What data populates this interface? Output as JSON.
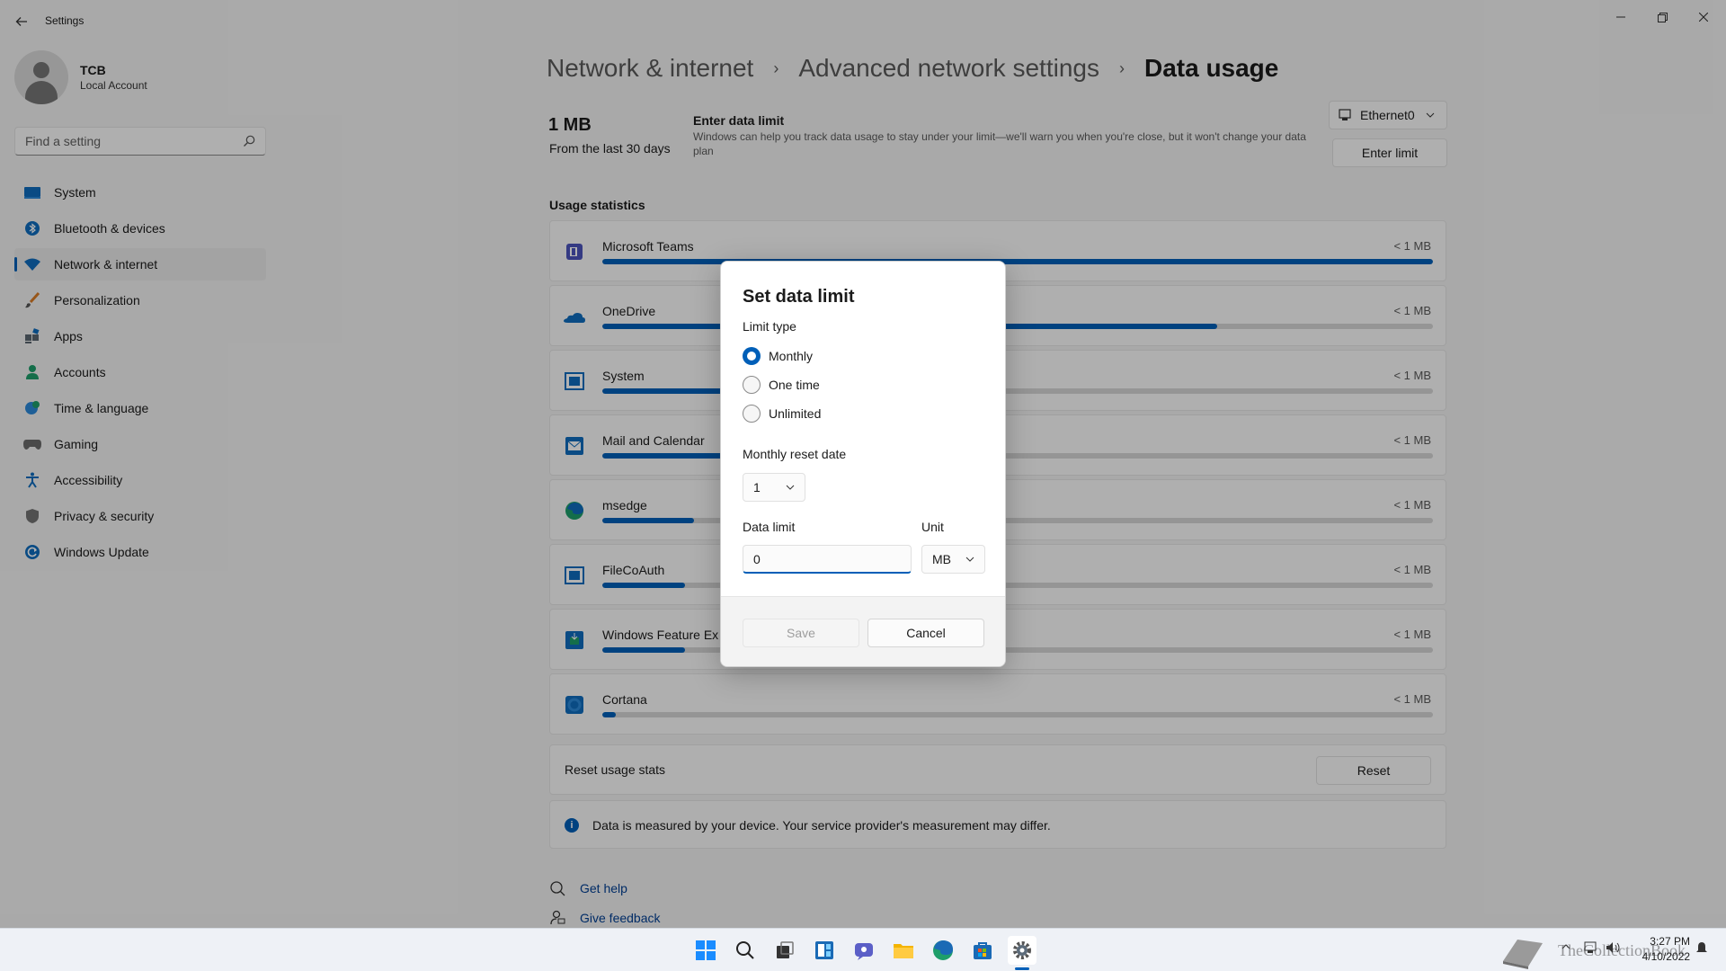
{
  "window": {
    "title": "Settings",
    "back_icon": "back-arrow-icon",
    "controls": [
      "minimize-icon",
      "maximize-icon",
      "close-icon"
    ]
  },
  "profile": {
    "name": "TCB",
    "account": "Local Account"
  },
  "search": {
    "placeholder": "Find a setting"
  },
  "sidebar": {
    "items": [
      {
        "label": "System",
        "icon": "system-icon"
      },
      {
        "label": "Bluetooth & devices",
        "icon": "bluetooth-icon"
      },
      {
        "label": "Network & internet",
        "icon": "wifi-icon",
        "active": true
      },
      {
        "label": "Personalization",
        "icon": "brush-icon"
      },
      {
        "label": "Apps",
        "icon": "apps-icon"
      },
      {
        "label": "Accounts",
        "icon": "accounts-icon"
      },
      {
        "label": "Time & language",
        "icon": "globe-clock-icon"
      },
      {
        "label": "Gaming",
        "icon": "gamepad-icon"
      },
      {
        "label": "Accessibility",
        "icon": "accessibility-icon"
      },
      {
        "label": "Privacy & security",
        "icon": "shield-icon"
      },
      {
        "label": "Windows Update",
        "icon": "update-icon"
      }
    ]
  },
  "breadcrumb": {
    "items": [
      "Network & internet",
      "Advanced network settings"
    ],
    "current": "Data usage"
  },
  "summary": {
    "amount": "1 MB",
    "period": "From the last 30 days",
    "limit_title": "Enter data limit",
    "limit_description": "Windows can help you track data usage to stay under your limit—we'll warn you when you're close, but it won't change your data plan",
    "adapter": "Ethernet0",
    "enter_limit_label": "Enter limit"
  },
  "usage": {
    "title": "Usage statistics",
    "apps": [
      {
        "name": "Microsoft Teams",
        "amount": "< 1 MB",
        "fraction": 1.0,
        "icon": "teams-icon"
      },
      {
        "name": "OneDrive",
        "amount": "< 1 MB",
        "fraction": 0.74,
        "icon": "onedrive-icon"
      },
      {
        "name": "System",
        "amount": "< 1 MB",
        "fraction": 0.4,
        "icon": "system-app-icon"
      },
      {
        "name": "Mail and Calendar",
        "amount": "< 1 MB",
        "fraction": 0.3,
        "icon": "mail-icon"
      },
      {
        "name": "msedge",
        "amount": "< 1 MB",
        "fraction": 0.11,
        "icon": "edge-icon"
      },
      {
        "name": "FileCoAuth",
        "amount": "< 1 MB",
        "fraction": 0.1,
        "icon": "filecoauth-icon"
      },
      {
        "name": "Windows Feature Experience Pack",
        "amount": "< 1 MB",
        "fraction": 0.1,
        "icon": "feature-pack-icon"
      },
      {
        "name": "Cortana",
        "amount": "< 1 MB",
        "fraction": 0.016,
        "icon": "cortana-icon"
      }
    ],
    "reset_label": "Reset usage stats",
    "reset_button": "Reset",
    "info": "Data is measured by your device. Your service provider's measurement may differ."
  },
  "help": {
    "get_help": "Get help",
    "give_feedback": "Give feedback"
  },
  "dialog": {
    "title": "Set data limit",
    "limit_type_label": "Limit type",
    "options": [
      "Monthly",
      "One time",
      "Unlimited"
    ],
    "selected_option": "Monthly",
    "reset_date_label": "Monthly reset date",
    "reset_date_value": "1",
    "data_limit_label": "Data limit",
    "data_limit_value": "0",
    "unit_label": "Unit",
    "unit_value": "MB",
    "save_label": "Save",
    "cancel_label": "Cancel"
  },
  "taskbar": {
    "icons": [
      "start-icon",
      "search-icon",
      "task-view-icon",
      "widgets-icon",
      "chat-icon",
      "file-explorer-icon",
      "edge-icon",
      "store-icon",
      "settings-icon"
    ],
    "time": "3:27 PM",
    "date": "4/10/2022",
    "watermark": "TheCollectionBook"
  },
  "colors": {
    "accent": "#005fb8",
    "background": "#f3f3f3",
    "card": "#fbfbfb"
  }
}
